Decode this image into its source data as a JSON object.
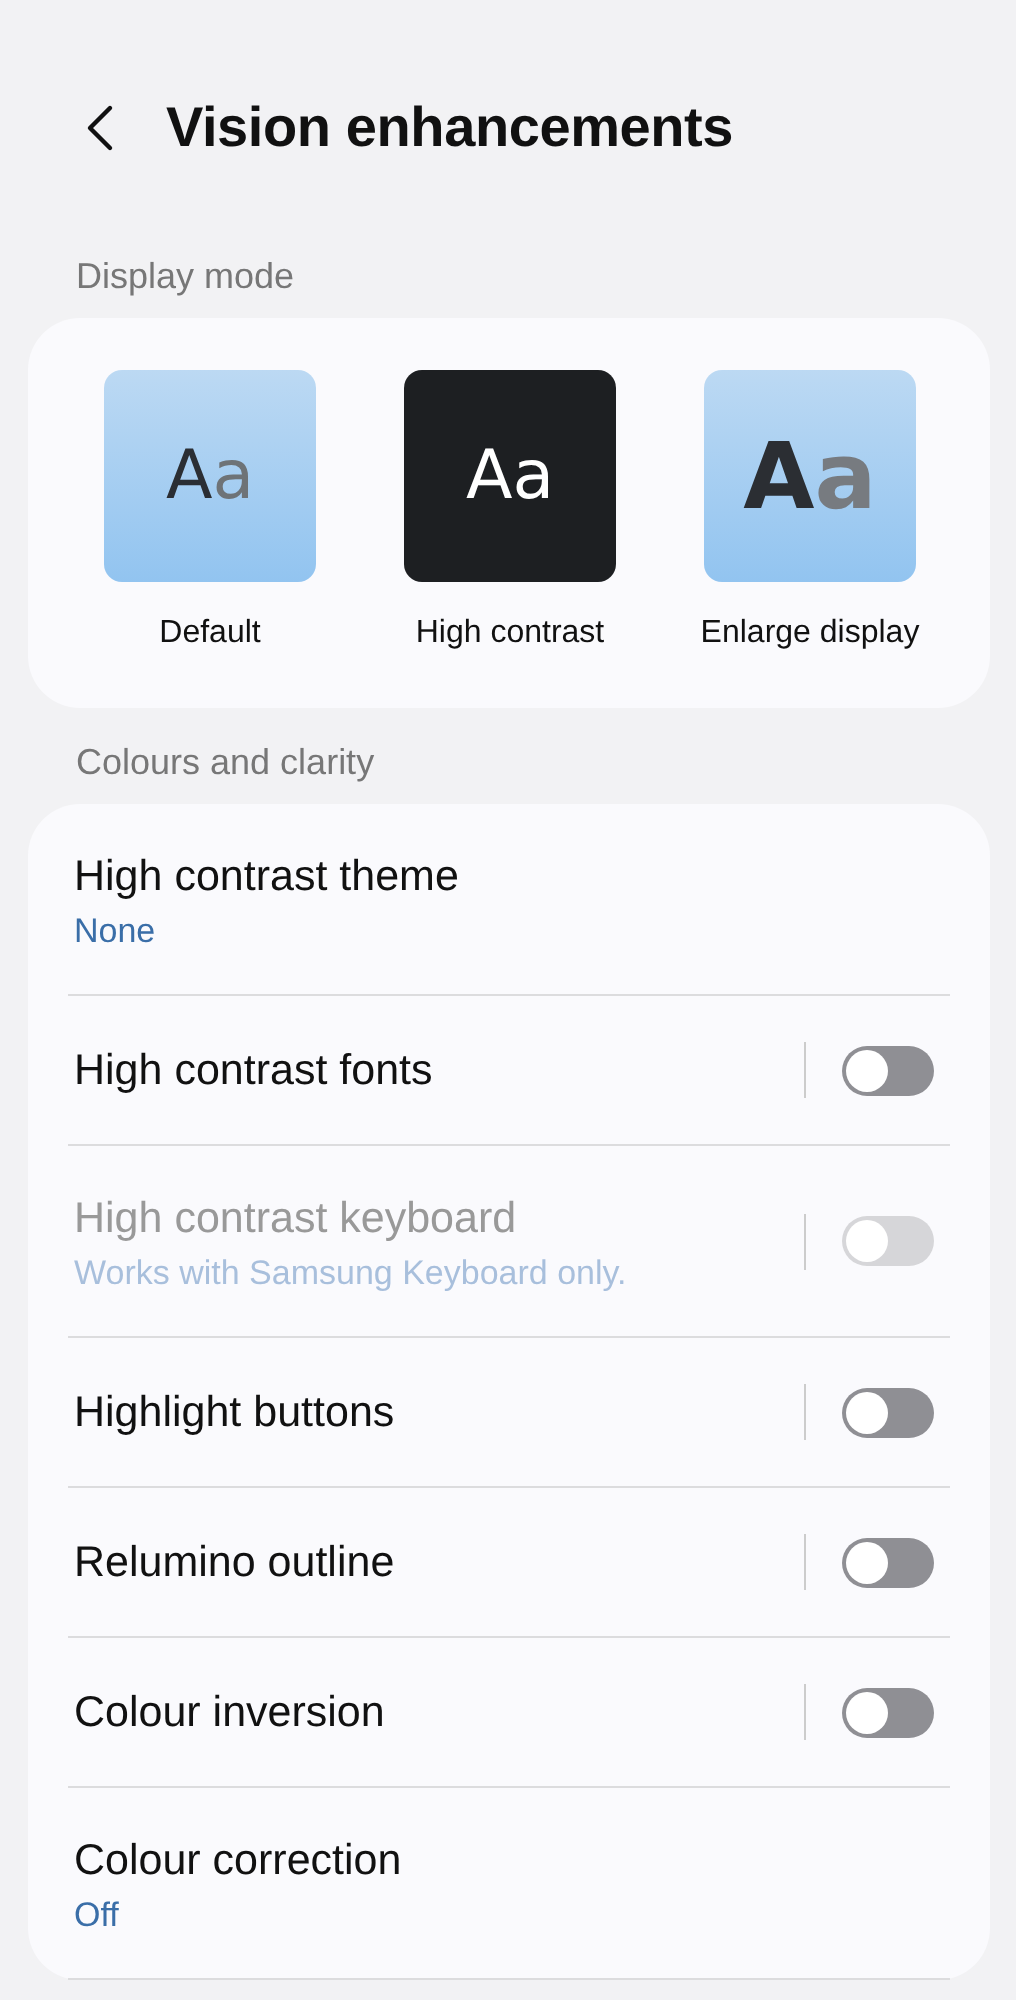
{
  "header": {
    "title": "Vision enhancements"
  },
  "display_mode": {
    "label": "Display mode",
    "options": [
      {
        "kind": "default",
        "sample": "Aa",
        "label": "Default"
      },
      {
        "kind": "contrast",
        "sample": "Aa",
        "label": "High contrast"
      },
      {
        "kind": "large",
        "sample": "Aa",
        "label": "Enlarge display"
      }
    ]
  },
  "colours_and_clarity": {
    "label": "Colours and clarity",
    "items": [
      {
        "kind": "link",
        "title": "High contrast theme",
        "summary": "None"
      },
      {
        "kind": "toggle",
        "title": "High contrast fonts",
        "on": false,
        "disabled": false
      },
      {
        "kind": "toggle",
        "title": "High contrast keyboard",
        "summary": "Works with Samsung Keyboard only.",
        "on": false,
        "disabled": true
      },
      {
        "kind": "toggle",
        "title": "Highlight buttons",
        "on": false,
        "disabled": false
      },
      {
        "kind": "toggle",
        "title": "Relumino outline",
        "on": false,
        "disabled": false
      },
      {
        "kind": "toggle",
        "title": "Colour inversion",
        "on": false,
        "disabled": false
      },
      {
        "kind": "link",
        "title": "Colour correction",
        "summary": "Off"
      }
    ]
  }
}
